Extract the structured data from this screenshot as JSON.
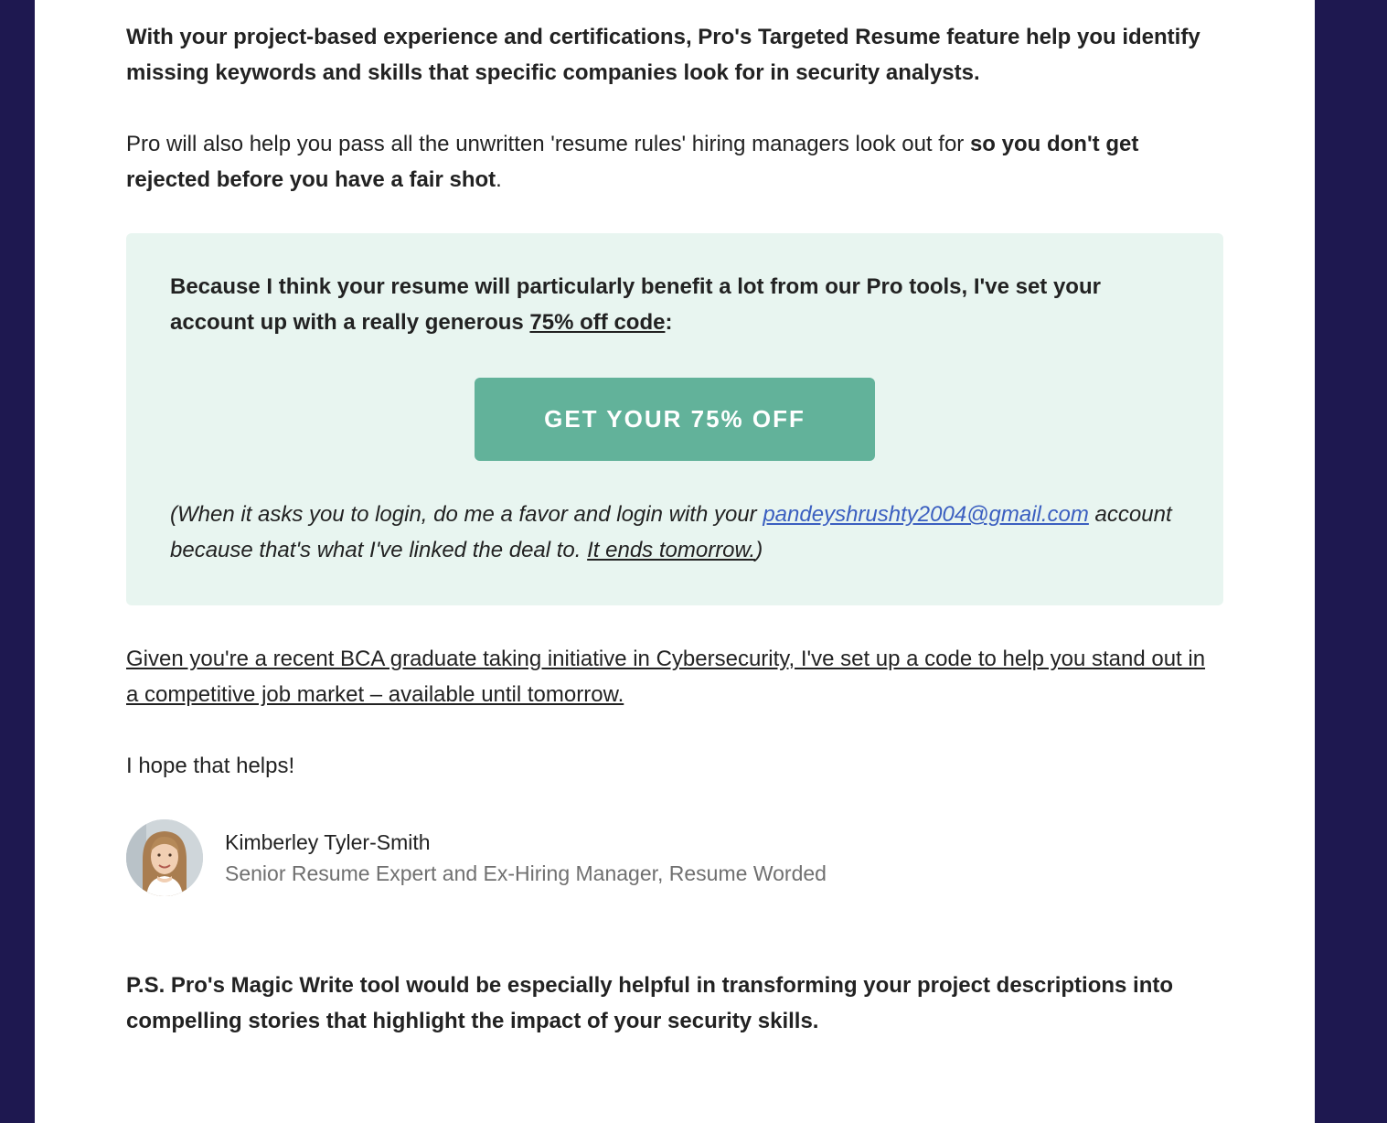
{
  "email": {
    "paragraph1": "With your project-based experience and certifications, Pro's Targeted Resume feature help you identify missing keywords and skills that specific companies look for in security analysts.",
    "paragraph2_normal": "Pro will also help you pass all the unwritten 'resume rules' hiring managers look out for ",
    "paragraph2_bold": "so you don't get rejected before you have a fair shot",
    "paragraph2_end": ".",
    "promo": {
      "text_before": "Because I think your resume will particularly benefit a lot from our Pro tools, I've set your account up with a really generous ",
      "code_text": "75% off code",
      "text_after": ":",
      "cta_label": "GET YOUR 75% OFF",
      "note_before": " (When it asks you to login, do me a favor and login with your ",
      "email_address": "pandeyshrushty2004@gmail.com",
      "note_middle": " account because that's what I've linked the deal to. ",
      "note_ends": "It ends tomorrow.",
      "note_close": ")"
    },
    "given_paragraph": "Given you're a recent BCA graduate taking initiative in Cybersecurity, I've set up a code to help you stand out in a competitive job market – available until tomorrow.",
    "hope": "I hope that helps!",
    "signature": {
      "name": "Kimberley Tyler-Smith",
      "title": "Senior Resume Expert and Ex-Hiring Manager, Resume Worded"
    },
    "ps": "P.S. Pro's Magic Write tool would be especially helpful in transforming your project descriptions into compelling stories that highlight the impact of your security skills."
  },
  "colors": {
    "page_background": "#1e1850",
    "promo_background": "#e8f5f0",
    "cta_background": "#62b29a",
    "link_color": "#3b5fc0"
  }
}
